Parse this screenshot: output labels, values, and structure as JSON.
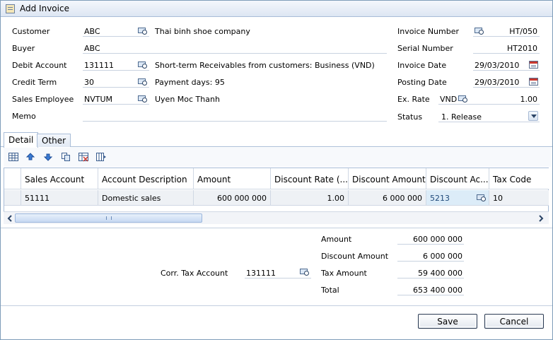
{
  "window": {
    "title": "Add Invoice"
  },
  "form": {
    "customer": {
      "label": "Customer",
      "code": "ABC",
      "name": "Thai binh shoe company"
    },
    "buyer": {
      "label": "Buyer",
      "value": "ABC"
    },
    "debit_account": {
      "label": "Debit Account",
      "code": "131111",
      "name": "Short-term Receivables from customers: Business (VND)"
    },
    "credit_term": {
      "label": "Credit Term",
      "code": "30",
      "name": "Payment days: 95"
    },
    "sales_employee": {
      "label": "Sales Employee",
      "code": "NVTUM",
      "name": "Uyen Moc Thanh"
    },
    "memo": {
      "label": "Memo",
      "value": ""
    },
    "invoice_number": {
      "label": "Invoice Number",
      "value": "HT/050"
    },
    "serial_number": {
      "label": "Serial Number",
      "value": "HT2010"
    },
    "invoice_date": {
      "label": "Invoice Date",
      "value": "29/03/2010"
    },
    "posting_date": {
      "label": "Posting Date",
      "value": "29/03/2010"
    },
    "ex_rate": {
      "label": "Ex. Rate",
      "currency": "VND",
      "value": "1.00"
    },
    "status": {
      "label": "Status",
      "value": "1. Release"
    }
  },
  "tabs": [
    {
      "label": "Detail",
      "active": true
    },
    {
      "label": "Other",
      "active": false
    }
  ],
  "toolbar": {
    "icons": [
      "insert-row-icon",
      "move-up-icon",
      "move-down-icon",
      "copy-row-icon",
      "delete-row-icon",
      "columns-icon"
    ]
  },
  "grid": {
    "columns": [
      "Sales Account",
      "Account Description",
      "Amount",
      "Discount Rate (...",
      "Discount Amount",
      "Discount Ac...",
      "Tax Code"
    ],
    "rows": [
      [
        "51111",
        "Domestic sales",
        "600 000 000",
        "1.00",
        "6 000 000",
        "5213",
        "10"
      ]
    ]
  },
  "totals": {
    "corr_tax_account": {
      "label": "Corr. Tax Account",
      "value": "131111"
    },
    "amount": {
      "label": "Amount",
      "value": "600 000 000"
    },
    "discount_amount": {
      "label": "Discount Amount",
      "value": "6 000 000"
    },
    "tax_amount": {
      "label": "Tax Amount",
      "value": "59 400 000"
    },
    "total": {
      "label": "Total",
      "value": "653 400 000"
    }
  },
  "buttons": {
    "save": "Save",
    "cancel": "Cancel"
  },
  "colors": {
    "border": "#7f9db9",
    "selected_cell": "#dcecf8",
    "row_bg": "#eef1f5"
  }
}
